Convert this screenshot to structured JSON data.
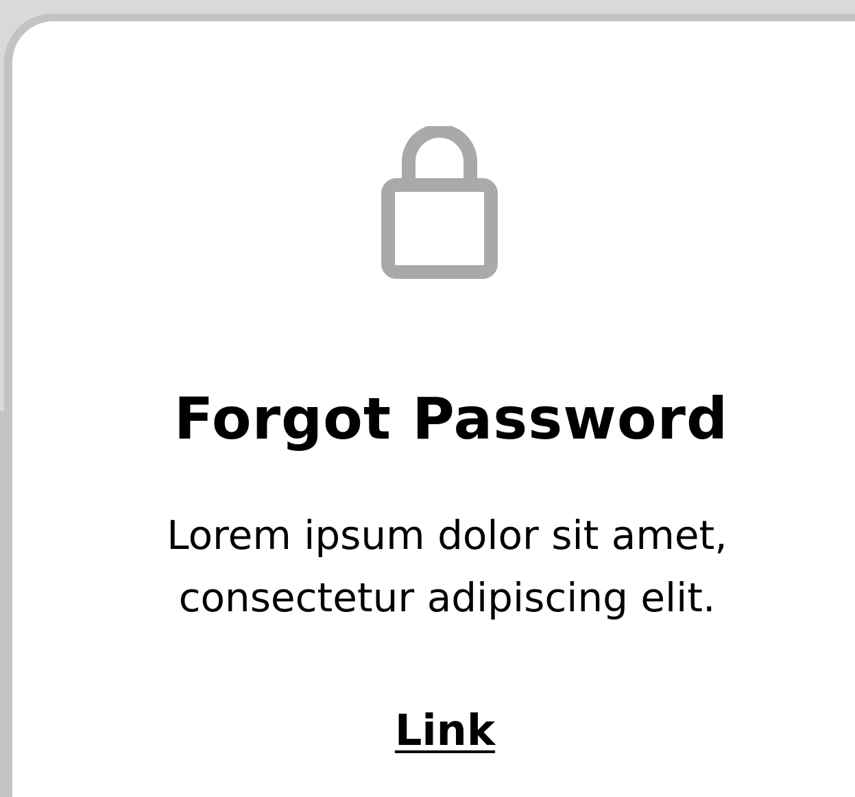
{
  "card": {
    "icon": "lock-icon",
    "title": "Forgot Password",
    "description_line1": "Lorem ipsum dolor sit amet,",
    "description_line2": "consectetur adipiscing elit.",
    "link_label": "Link"
  },
  "colors": {
    "background": "#d9d9d9",
    "card": "#ffffff",
    "icon": "#a9a9a9",
    "text": "#000000"
  }
}
